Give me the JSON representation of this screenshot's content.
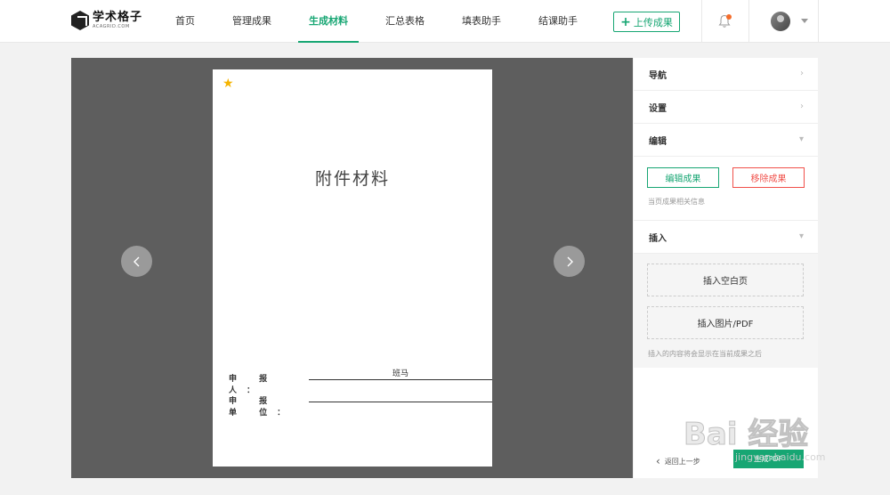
{
  "header": {
    "logo_name": "学术格子",
    "logo_sub": "ACAGRID.COM",
    "nav": [
      "首页",
      "管理成果",
      "生成材料",
      "汇总表格",
      "填表助手",
      "结课助手"
    ],
    "active_nav": "生成材料",
    "upload_label": "上传成果"
  },
  "document": {
    "title": "附件材料",
    "applicant_label": "申 报 人：",
    "applicant_value": "班马",
    "unit_label": "申 报 单 位：",
    "unit_value": ""
  },
  "panel": {
    "nav_label": "导航",
    "settings_label": "设置",
    "edit_label": "编辑",
    "edit_button": "编辑成果",
    "remove_button": "移除成果",
    "edit_hint": "当页成果相关信息",
    "insert_label": "插入",
    "insert_blank": "插入空白页",
    "insert_image": "插入图片/PDF",
    "insert_hint": "插入的内容将会显示在当前成果之后",
    "back_label": "返回上一步",
    "generate_label": "生成PDF"
  },
  "watermark": {
    "main": "Bai 经验",
    "sub": "jingyan.baidu.com"
  },
  "colors": {
    "accent": "#17a673",
    "danger": "#f0504a",
    "viewer_bg": "#5e5e5e"
  }
}
